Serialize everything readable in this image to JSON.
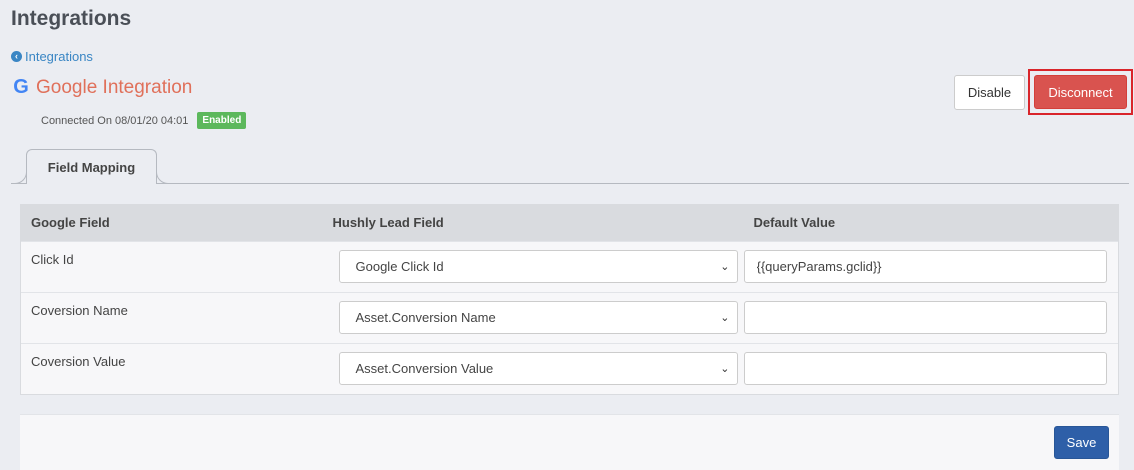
{
  "page": {
    "title": "Integrations"
  },
  "breadcrumb": {
    "back_label": "Integrations"
  },
  "integration": {
    "name": "Google Integration",
    "connected_text": "Connected On 08/01/20 04:01",
    "status_badge": "Enabled",
    "icon": "google-g-icon"
  },
  "actions": {
    "disable_label": "Disable",
    "disconnect_label": "Disconnect"
  },
  "tabs": [
    {
      "label": "Field Mapping"
    }
  ],
  "table": {
    "headers": [
      "Google Field",
      "Hushly Lead Field",
      "Default Value"
    ],
    "rows": [
      {
        "google_field": "Click Id",
        "lead_field": "Google Click Id",
        "default_value": "{{queryParams.gclid}}"
      },
      {
        "google_field": "Coversion Name",
        "lead_field": "Asset.Conversion Name",
        "default_value": ""
      },
      {
        "google_field": "Coversion Value",
        "lead_field": "Asset.Conversion Value",
        "default_value": ""
      }
    ]
  },
  "footer": {
    "save_label": "Save"
  },
  "colors": {
    "accent": "#2e5fa8",
    "danger": "#d9534f",
    "success": "#5cb85c",
    "integration_title": "#e0705a"
  }
}
